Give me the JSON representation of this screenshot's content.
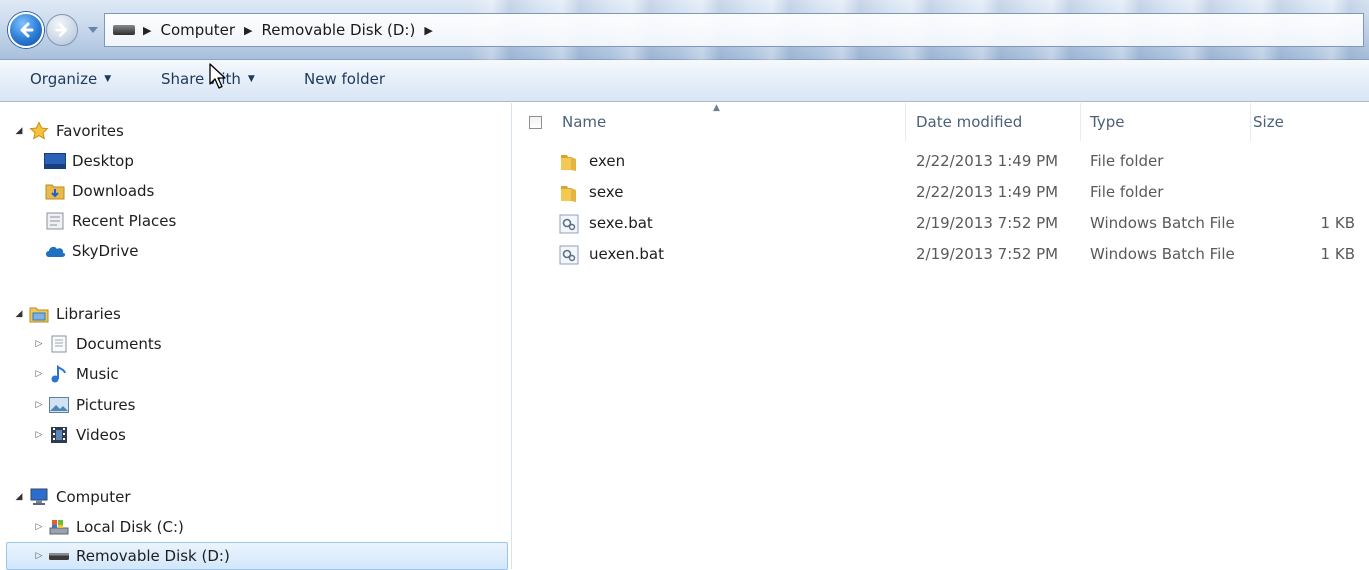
{
  "address": {
    "crumbs": [
      "Computer",
      "Removable Disk (D:)"
    ]
  },
  "toolbar": {
    "organize_label": "Organize",
    "share_label": "Share with",
    "new_folder_label": "New folder"
  },
  "nav": {
    "favorites": {
      "label": "Favorites",
      "items": [
        "Desktop",
        "Downloads",
        "Recent Places",
        "SkyDrive"
      ]
    },
    "libraries": {
      "label": "Libraries",
      "items": [
        "Documents",
        "Music",
        "Pictures",
        "Videos"
      ]
    },
    "computer": {
      "label": "Computer",
      "items": [
        "Local Disk (C:)",
        "Removable Disk (D:)"
      ]
    }
  },
  "columns": {
    "name": "Name",
    "date": "Date modified",
    "type": "Type",
    "size": "Size"
  },
  "files": [
    {
      "name": "exen",
      "date": "2/22/2013 1:49 PM",
      "type": "File folder",
      "size": "",
      "icon": "folder-icon"
    },
    {
      "name": "sexe",
      "date": "2/22/2013 1:49 PM",
      "type": "File folder",
      "size": "",
      "icon": "folder-icon"
    },
    {
      "name": "sexe.bat",
      "date": "2/19/2013 7:52 PM",
      "type": "Windows Batch File",
      "size": "1 KB",
      "icon": "batch-file-icon"
    },
    {
      "name": "uexen.bat",
      "date": "2/19/2013 7:52 PM",
      "type": "Windows Batch File",
      "size": "1 KB",
      "icon": "batch-file-icon"
    }
  ],
  "colors": {
    "accent": "#1e395b",
    "selection": "#d2e7fb",
    "header_text": "#4c607a"
  }
}
